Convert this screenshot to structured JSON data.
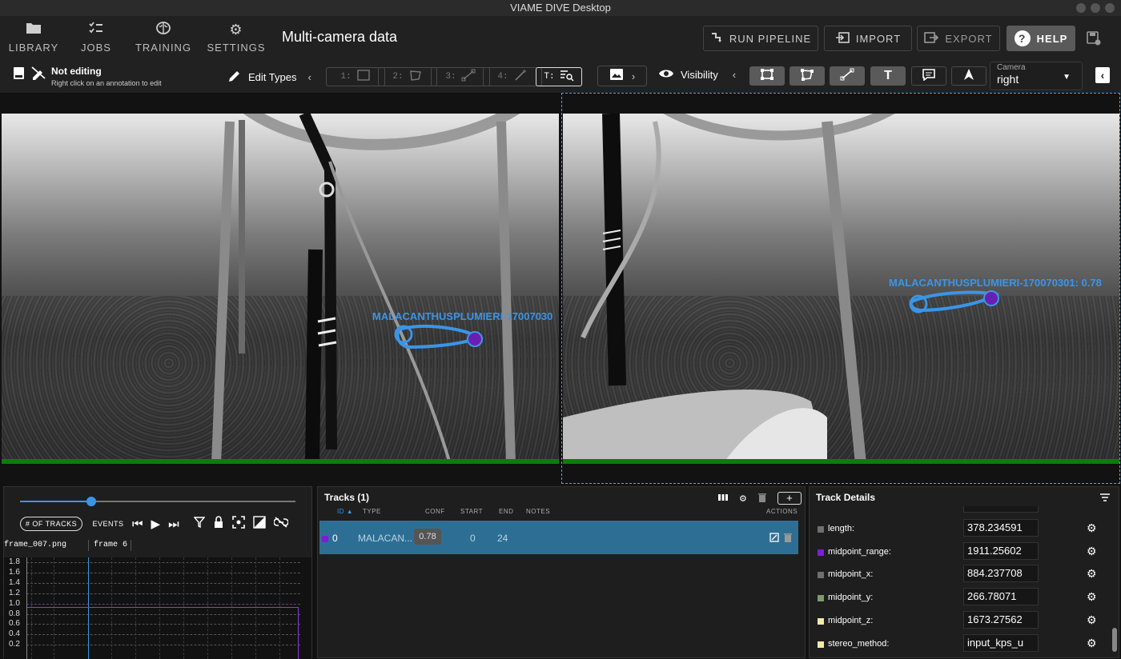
{
  "window": {
    "title": "VIAME DIVE Desktop"
  },
  "nav": {
    "library": "LIBRARY",
    "jobs": "JOBS",
    "training": "TRAINING",
    "settings": "SETTINGS"
  },
  "page_title": "Multi-camera data",
  "actions": {
    "run_pipeline": "RUN PIPELINE",
    "import": "IMPORT",
    "export": "EXPORT",
    "help": "HELP"
  },
  "editor": {
    "status": "Not editing",
    "hint": "Right click on an annotation to edit",
    "edit_types": "Edit Types",
    "modes": [
      "1:",
      "2:",
      "3:",
      "4:",
      "T:"
    ],
    "visibility": "Visibility",
    "camera_label": "Camera",
    "camera_value": "right"
  },
  "viewer": {
    "left_label": "MALACANTHUSPLUMIERI-17007030",
    "right_label": "MALACANTHUSPLUMIERI-170070301: 0.78"
  },
  "timeline": {
    "btn_tracks": "# OF TRACKS",
    "btn_events": "EVENTS",
    "filename": "frame_007.png",
    "frame": "frame 6",
    "progress": 0.26,
    "ticks": [
      "1.8",
      "1.6",
      "1.4",
      "1.2",
      "1.0",
      "0.8",
      "0.6",
      "0.4",
      "0.2"
    ]
  },
  "tracks": {
    "title": "Tracks (1)",
    "headers": {
      "id": "ID",
      "type": "TYPE",
      "conf": "CONF",
      "start": "START",
      "end": "END",
      "notes": "NOTES",
      "actions": "ACTIONS"
    },
    "rows": [
      {
        "id": "0",
        "type": "MALACAN...",
        "conf": "0.78",
        "start": "0",
        "end": "24",
        "color": "#7b1fd4"
      }
    ]
  },
  "details": {
    "title": "Track Details",
    "rows": [
      {
        "name": "length:",
        "value": "378.234591",
        "color": "#6f6f6f"
      },
      {
        "name": "midpoint_range:",
        "value": "1911.25602",
        "color": "#7b1fd4"
      },
      {
        "name": "midpoint_x:",
        "value": "884.237708",
        "color": "#6f6f6f"
      },
      {
        "name": "midpoint_y:",
        "value": "266.78071",
        "color": "#7b9b6f"
      },
      {
        "name": "midpoint_z:",
        "value": "1673.27562",
        "color": "#f3e9a8"
      },
      {
        "name": "stereo_method:",
        "value": "input_kps_u",
        "color": "#f3e9a8"
      }
    ]
  }
}
